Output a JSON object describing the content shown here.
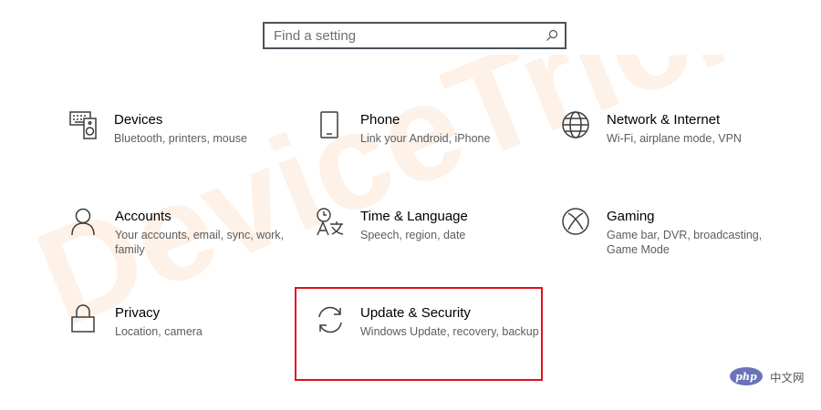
{
  "search": {
    "placeholder": "Find a setting",
    "icon": "search-icon"
  },
  "tiles": [
    {
      "title": "Devices",
      "description": "Bluetooth, printers, mouse",
      "icon": "devices-icon"
    },
    {
      "title": "Phone",
      "description": "Link your Android, iPhone",
      "icon": "phone-icon"
    },
    {
      "title": "Network & Internet",
      "description": "Wi-Fi, airplane mode, VPN",
      "icon": "globe-icon"
    },
    {
      "title": "Accounts",
      "description": "Your accounts, email, sync, work, family",
      "icon": "person-icon"
    },
    {
      "title": "Time & Language",
      "description": "Speech, region, date",
      "icon": "time-language-icon"
    },
    {
      "title": "Gaming",
      "description": "Game bar, DVR, broadcasting, Game Mode",
      "icon": "xbox-icon"
    },
    {
      "title": "Privacy",
      "description": "Location, camera",
      "icon": "lock-icon"
    },
    {
      "title": "Update & Security",
      "description": "Windows Update, recovery, backup",
      "icon": "sync-icon"
    }
  ],
  "highlight": {
    "target": "Update & Security",
    "color": "#e0101a"
  },
  "watermark": {
    "text": "DeviceTricks",
    "color": "#fdf1e8"
  },
  "php_badge": {
    "logo": "php",
    "site": "中文网"
  },
  "colors": {
    "icon": "#3c3c3c",
    "description": "#5d5d5d",
    "search_border": "#4a525a",
    "php_blue": "#6a74b7"
  }
}
